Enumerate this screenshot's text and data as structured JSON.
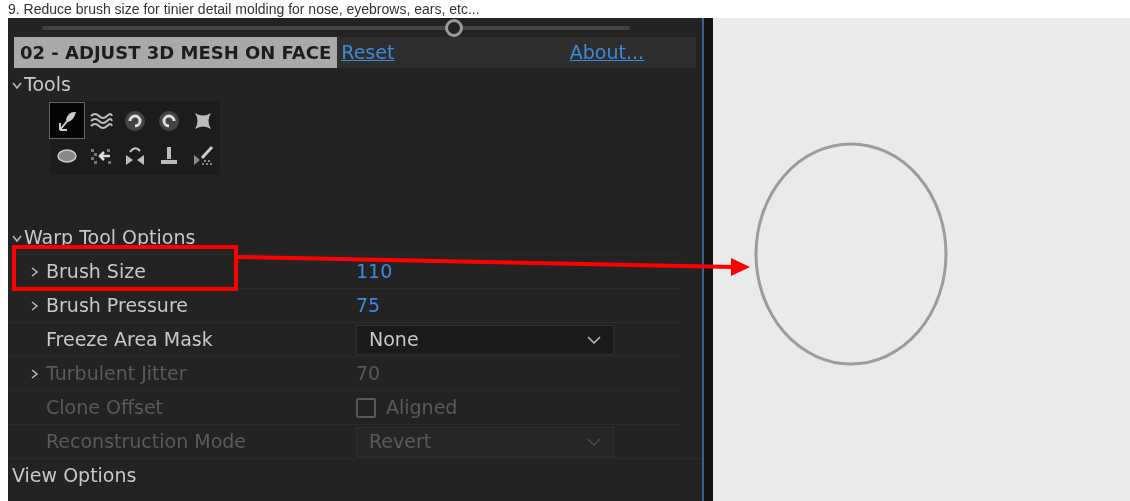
{
  "caption": "9. Reduce brush size for tinier detail molding for nose, eyebrows, ears, etc...",
  "slider": {
    "level": 0.7
  },
  "header": {
    "title": "02 - ADJUST 3D MESH ON FACE",
    "reset": "Reset",
    "about": "About..."
  },
  "tools_section": {
    "label": "Tools",
    "expanded": true,
    "tools": [
      {
        "kind": "warp",
        "selected": true
      },
      {
        "kind": "turbulence",
        "selected": false
      },
      {
        "kind": "twirl-cw",
        "selected": false
      },
      {
        "kind": "twirl-ccw",
        "selected": false
      },
      {
        "kind": "pucker",
        "selected": false
      },
      {
        "kind": "bloat",
        "selected": false
      },
      {
        "kind": "shift",
        "selected": false
      },
      {
        "kind": "reflect",
        "selected": false
      },
      {
        "kind": "clone",
        "selected": false
      },
      {
        "kind": "reconstruct",
        "selected": false
      }
    ]
  },
  "warp_section": {
    "label": "Warp Tool Options",
    "expanded": true,
    "rows": [
      {
        "kind": "number",
        "label": "Brush Size",
        "value": "110",
        "expandable": true,
        "disabled": false
      },
      {
        "kind": "number",
        "label": "Brush Pressure",
        "value": "75",
        "expandable": true,
        "disabled": false
      },
      {
        "kind": "dropdown",
        "label": "Freeze Area Mask",
        "value": "None",
        "expandable": false,
        "disabled": false
      },
      {
        "kind": "number",
        "label": "Turbulent Jitter",
        "value": "70",
        "expandable": true,
        "disabled": true
      },
      {
        "kind": "checkbox",
        "label": "Clone Offset",
        "value": "Aligned",
        "checked": false,
        "expandable": false,
        "disabled": true
      },
      {
        "kind": "dropdown",
        "label": "Reconstruction Mode",
        "value": "Revert",
        "expandable": false,
        "disabled": true
      }
    ]
  },
  "view_section": {
    "label": "View Options"
  }
}
